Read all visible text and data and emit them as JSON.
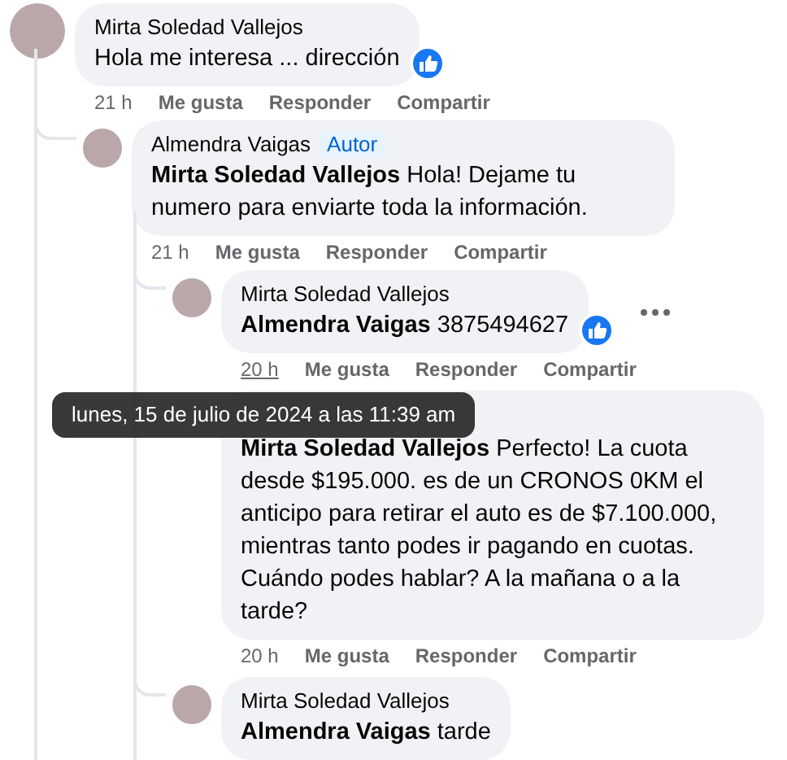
{
  "comments": [
    {
      "author": "Mirta Soledad Vallejos",
      "body": "Hola me interesa ... dirección",
      "like_reaction": true,
      "time": "21 h",
      "time_hovered": false,
      "actions": [
        "Me gusta",
        "Responder",
        "Compartir"
      ],
      "children": [
        {
          "author": "Almendra Vaigas",
          "badge": "Autor",
          "body": "**Mirta Soledad Vallejos** Hola! Dejame tu numero para enviarte toda la información.",
          "time": "21 h",
          "time_hovered": false,
          "actions": [
            "Me gusta",
            "Responder",
            "Compartir"
          ],
          "children": [
            {
              "author": "Mirta Soledad Vallejos",
              "body": "**Almendra Vaigas** 3875494627",
              "like_reaction": true,
              "more_menu": true,
              "time": "20 h",
              "time_hovered": true,
              "actions": [
                "Me gusta",
                "Responder",
                "Compartir"
              ]
            },
            {
              "body": "**Mirta Soledad Vallejos** Perfecto! La cuota desde $195.000. es de un CRONOS 0KM el anticipo para retirar el auto es de $7.100.000, mientras tanto podes ir pagando en cuotas. Cuándo podes hablar? A la mañana o a la tarde?",
              "time": "20 h",
              "time_hovered": false,
              "actions": [
                "Me gusta",
                "Responder",
                "Compartir"
              ]
            },
            {
              "author": "Mirta Soledad Vallejos",
              "body": "**Almendra Vaigas** tarde"
            }
          ]
        }
      ]
    }
  ],
  "tooltip": {
    "text": "lunes, 15 de julio de 2024 a las 11:39 am"
  }
}
